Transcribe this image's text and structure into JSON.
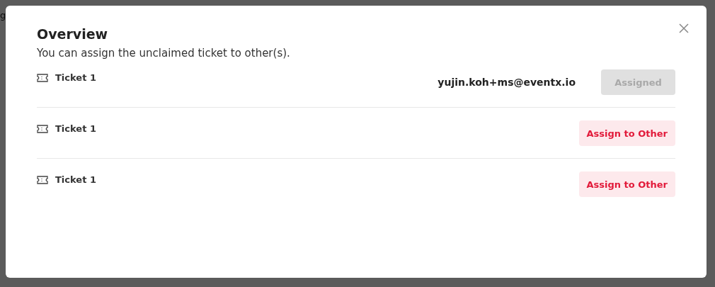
{
  "backdrop": {
    "partial_text": "g"
  },
  "dialog": {
    "title": "Overview",
    "subtitle": "You can assign the unclaimed ticket to other(s).",
    "tickets": [
      {
        "label": "Ticket 1",
        "assignee": "yujin.koh+ms@eventx.io",
        "action": {
          "label": "Assigned",
          "disabled": true
        }
      },
      {
        "label": "Ticket 1",
        "action": {
          "label": "Assign to Other",
          "disabled": false
        }
      },
      {
        "label": "Ticket 1",
        "action": {
          "label": "Assign to Other",
          "disabled": false
        }
      }
    ]
  }
}
